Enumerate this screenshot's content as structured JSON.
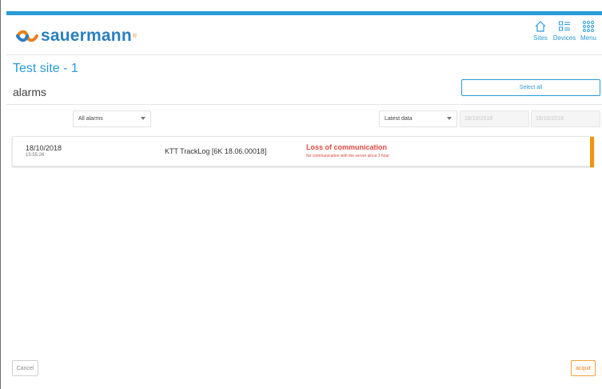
{
  "brand": {
    "logo_text": "sauermann",
    "logo_mark": "®",
    "accent_color": "#2a9bd8",
    "brand_color": "#2a7fc0",
    "orange": "#e8821e"
  },
  "nav": {
    "items": [
      {
        "label": "Sites",
        "icon": "home-icon"
      },
      {
        "label": "Devices",
        "icon": "device-list-icon"
      },
      {
        "label": "Menu",
        "icon": "grid-menu-icon"
      }
    ]
  },
  "site": {
    "title": "Test site - 1"
  },
  "page": {
    "title": "alarms"
  },
  "actions": {
    "select_all": "Select all",
    "cancel": "Cancel",
    "acquit": "acquit"
  },
  "filters": {
    "alarm_type": "All alarms",
    "data_range": "Latest data",
    "date_from": "18/10/2018",
    "date_to": "18/10/2018"
  },
  "alarms": [
    {
      "date": "18/10/2018",
      "time": "15:55:26",
      "device": "KTT TrackLog [6K 18.06.00018]",
      "type": "Loss of communication",
      "description": "No communication with the server since 1 hour",
      "status_color": "#f0950c",
      "type_color": "#e04a3c"
    }
  ]
}
